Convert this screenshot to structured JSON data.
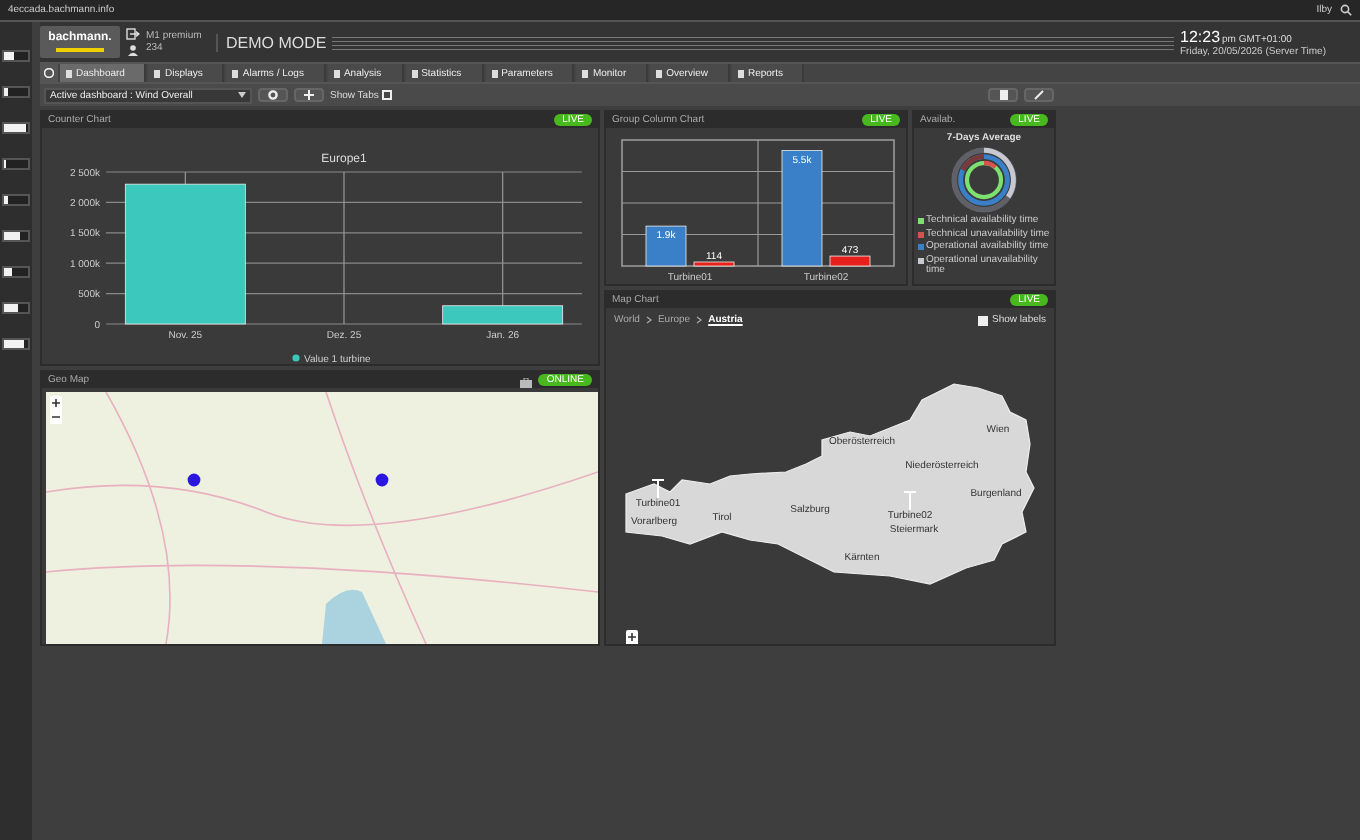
{
  "browser": {
    "url": "4eccada.bachmann.info",
    "user": "Ilby"
  },
  "sidebar": {
    "gauges": [
      {
        "level": 0.4
      },
      {
        "level": 0.2
      },
      {
        "level": 0.9
      },
      {
        "level": 0.1
      },
      {
        "level": 0.15
      },
      {
        "level": 0.7
      },
      {
        "level": 0.3
      },
      {
        "level": 0.6
      },
      {
        "level": 0.8
      }
    ]
  },
  "header": {
    "logo": "bachmann.",
    "account": "M1 premium",
    "count": "234",
    "mode": "DEMO MODE",
    "time": "12:23",
    "time_suffix": "pm GMT+01:00",
    "date": "Friday, 20/05/2026 (Server Time)"
  },
  "tabs": [
    {
      "label": "Dashboard",
      "selected": true
    },
    {
      "label": "Displays",
      "selected": false
    },
    {
      "label": "Alarms / Logs",
      "selected": false
    },
    {
      "label": "Analysis",
      "selected": false
    },
    {
      "label": "Statistics",
      "selected": false
    },
    {
      "label": "Parameters",
      "selected": false
    },
    {
      "label": "Monitor",
      "selected": false
    },
    {
      "label": "Overview",
      "selected": false
    },
    {
      "label": "Reports",
      "selected": false
    }
  ],
  "toolbar": {
    "dashboard_select": "Active dashboard : Wind Overall",
    "show_tabs": {
      "label": "Show Tabs",
      "checked": false
    }
  },
  "counter_chart": {
    "title": "Counter Chart",
    "toggle": {
      "label": "LIVE",
      "on": true
    },
    "chart_data": {
      "type": "bar",
      "title": "Europe1",
      "grid": true,
      "categories": [
        "Nov. 25",
        "Dez. 25",
        "Jan. 26"
      ],
      "series": [
        {
          "name": "Value 1 turbine",
          "color": "#3cc8bc",
          "values": [
            2300000,
            0,
            300000
          ]
        }
      ],
      "ylim": [
        0,
        2500000
      ],
      "yticks": [
        {
          "value": 0,
          "label": "0"
        },
        {
          "value": 500000,
          "label": "500k"
        },
        {
          "value": 1000000,
          "label": "1 000k"
        },
        {
          "value": 1500000,
          "label": "1 500k"
        },
        {
          "value": 2000000,
          "label": "2 000k"
        },
        {
          "value": 2500000,
          "label": "2 500k"
        }
      ]
    }
  },
  "group_chart": {
    "title": "Group Column Chart",
    "toggle": {
      "label": "LIVE",
      "on": true
    },
    "chart_data": {
      "type": "bar",
      "grid": true,
      "categories": [
        "Turbine01",
        "Turbine02"
      ],
      "series": [
        {
          "color": "#3a80c8",
          "values": [
            1900,
            5500
          ],
          "value_labels": [
            "1.9k",
            "5.5k"
          ]
        },
        {
          "color": "#e8201c",
          "values": [
            114,
            473
          ],
          "value_labels": [
            "114",
            "473"
          ]
        }
      ]
    }
  },
  "availability": {
    "title": "Availab.",
    "toggle": {
      "label": "LIVE",
      "on": true
    },
    "subtitle": "7-Days Average",
    "legend": [
      {
        "label": "Technical availability time",
        "color": "#7ee070"
      },
      {
        "label": "Technical unavailability time",
        "color": "#d85050"
      },
      {
        "label": "Operational availability time",
        "color": "#3a80c8"
      },
      {
        "label": "Operational unavailability time",
        "color": "#c8c8d0"
      }
    ]
  },
  "geo_map": {
    "title": "Geo Map",
    "toggle": {
      "label": "ONLINE",
      "on": true
    }
  },
  "map_chart": {
    "title": "Map Chart",
    "toggle": {
      "label": "LIVE",
      "on": true
    },
    "breadcrumb": [
      {
        "label": "World",
        "selected": false
      },
      {
        "label": "Europe",
        "selected": false
      },
      {
        "label": "Austria",
        "selected": true
      }
    ],
    "show_labels": {
      "label": "Show labels",
      "checked": true
    },
    "regions": [
      "Oberösterreich",
      "Niederösterreich",
      "Wien",
      "Burgenland",
      "Vorarlberg",
      "Tirol",
      "Salzburg",
      "Steiermark",
      "Kärnten"
    ],
    "markers": [
      "Turbine01",
      "Turbine02"
    ]
  }
}
